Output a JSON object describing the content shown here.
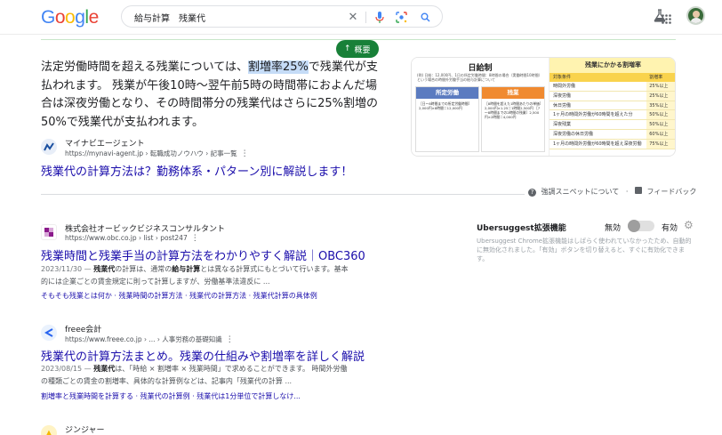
{
  "header": {
    "logo_letters": [
      "G",
      "o",
      "o",
      "g",
      "l",
      "e"
    ],
    "logo_colors": [
      "#4285F4",
      "#EA4335",
      "#FBBC05",
      "#4285F4",
      "#34A853",
      "#EA4335"
    ],
    "search_query": "給与計算　残業代"
  },
  "overview_button": "概要",
  "featured_snippet": {
    "text_before": "法定労働時間を超える残業については、",
    "highlight": "割増率25%",
    "text_after": "で残業代が支払われます。 残業が午後10時〜翌午前5時の時間帯におよんだ場合は深夜労働となり、その時間帯分の残業代はさらに25%割増の50%で残業代が支払われます。",
    "source_name": "マイナビエージェント",
    "source_url": "https://mynavi-agent.jp › 転職成功ノウハウ › 記事一覧",
    "title": "残業代の計算方法は？勤務体系・パターン別に解説します！",
    "image": {
      "left_title": "日給制",
      "left_caption": "(例) 日給：12,000円、1日の所定労働時間：8時間の場合（実働時間10時間）という場合の時間外労働手当の給与計算について",
      "box1_title": "所定労働",
      "box1_text": "［日～8時間までの所定労働時間］2,000円×8時間＝12,000円",
      "box2_title": "残業",
      "box2_text": "［8時間を超えた1時間あたりの単価］2,000円×1.25＝1時間2,500円 ［7～8時間までの2時間の残業］2,500円×2時間＝4,000円",
      "right_title": "残業にかかる割増率",
      "col1": "対象条件",
      "col2": "割増率",
      "rows": [
        {
          "cond": "時間外労働",
          "rate": "25%以上"
        },
        {
          "cond": "深夜労働",
          "rate": "25%以上"
        },
        {
          "cond": "休日労働",
          "rate": "35%以上"
        },
        {
          "cond": "1ヶ月の時間外労働が60時間を超えた分",
          "rate": "50%以上"
        },
        {
          "cond": "深夜残業",
          "rate": "50%以上"
        },
        {
          "cond": "深夜労働の休日労働",
          "rate": "60%以上"
        },
        {
          "cond": "1ヶ月の時間外労働が60時間を超え深夜労働",
          "rate": "75%以上"
        }
      ]
    }
  },
  "snippet_footer": {
    "about": "強調スニペットについて",
    "feedback": "フィードバック"
  },
  "results": [
    {
      "source_name": "株式会社オービックビジネスコンサルタント",
      "source_url": "https://www.obc.co.jp › list › post247",
      "title": "残業時間と残業手当の計算方法をわかりやすく解説｜OBC360",
      "meta_line1_date": "2023/11/30 — ",
      "meta_line1_bold": "残業代",
      "meta_line1_rest": "の計算は、通常の",
      "meta_line1_bold2": "給与計算",
      "meta_line1_rest2": "とは異なる計算式にもとづいて行います。基本",
      "meta_line2": "的には企業ごとの賃金規定に則って計算しますが、労働基準法違反に ...",
      "sitelinks": "そもそも残業とは何か · 残業時間の計算方法 · 残業代の計算方法 · 残業代計算の具体例"
    },
    {
      "source_name": "freee会計",
      "source_url": "https://www.freee.co.jp › ... › 人事労務の基礎知識",
      "title": "残業代の計算方法まとめ。残業の仕組みや割増率を詳しく解説",
      "meta_line1_date": "2023/08/15 — ",
      "meta_line1_bold": "残業代",
      "meta_line1_rest": "は、「時給 × 割増率 × 残業時間」で求めることができます。 時間外労働",
      "meta_line1_bold2": "",
      "meta_line1_rest2": "",
      "meta_line2": "の種類ごとの賃金の割増率、具体的な計算例などは、記事内「残業代の計算 ...",
      "sitelinks": "割増率と残業時間を計算する · 残業代の計算例 · 残業代は1分単位で計算しなけ..."
    },
    {
      "source_name": "ジンジャー"
    }
  ],
  "ubersuggest": {
    "title": "Ubersuggest拡張機能",
    "off_label": "無効",
    "on_label": "有効",
    "description": "Ubersuggest Chrome拡張機能はしばらく使われていなかったため、自動的に無効化されました。「有効」ボタンを切り替えると、すぐに有効化できます。"
  }
}
